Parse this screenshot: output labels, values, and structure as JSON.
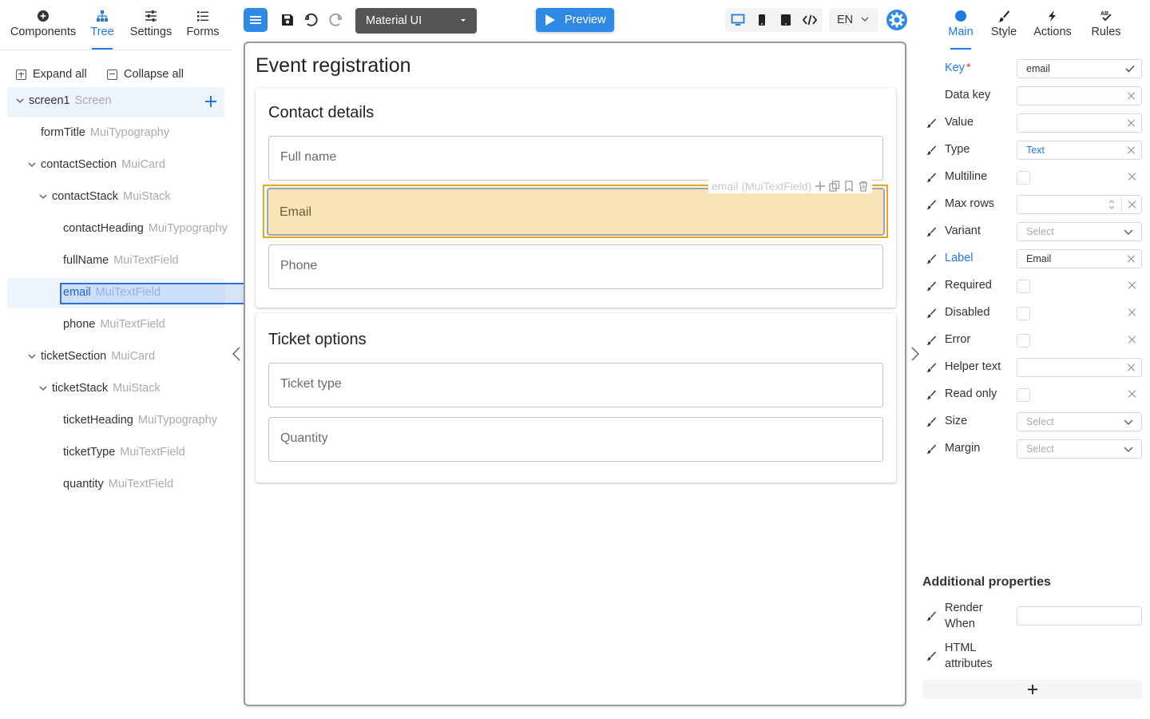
{
  "left_tabs": [
    {
      "label": "Components",
      "icon": "plus-circle-icon"
    },
    {
      "label": "Tree",
      "icon": "hierarchy-icon",
      "active": true
    },
    {
      "label": "Settings",
      "icon": "sliders-icon"
    },
    {
      "label": "Forms",
      "icon": "list-icon"
    }
  ],
  "tree_actions": {
    "expand_all": "Expand all",
    "collapse_all": "Collapse all"
  },
  "tree": [
    {
      "name": "screen1",
      "type": "Screen"
    },
    {
      "name": "formTitle",
      "type": "MuiTypography"
    },
    {
      "name": "contactSection",
      "type": "MuiCard"
    },
    {
      "name": "contactStack",
      "type": "MuiStack"
    },
    {
      "name": "contactHeading",
      "type": "MuiTypography"
    },
    {
      "name": "fullName",
      "type": "MuiTextField"
    },
    {
      "name": "email",
      "type": "MuiTextField",
      "selected": true
    },
    {
      "name": "phone",
      "type": "MuiTextField"
    },
    {
      "name": "ticketSection",
      "type": "MuiCard"
    },
    {
      "name": "ticketStack",
      "type": "MuiStack"
    },
    {
      "name": "ticketHeading",
      "type": "MuiTypography"
    },
    {
      "name": "ticketType",
      "type": "MuiTextField"
    },
    {
      "name": "quantity",
      "type": "MuiTextField"
    }
  ],
  "toolbar": {
    "theme": "Material UI",
    "preview": "Preview",
    "language": "EN"
  },
  "canvas": {
    "title": "Event registration",
    "contact_heading": "Contact details",
    "full_name": "Full name",
    "email": "Email",
    "phone": "Phone",
    "ticket_heading": "Ticket options",
    "ticket_type": "Ticket type",
    "quantity": "Quantity",
    "selected_label": "email (MuiTextField)"
  },
  "right_tabs": [
    {
      "label": "Main",
      "icon": "circle-icon",
      "active": true
    },
    {
      "label": "Style",
      "icon": "brush-icon"
    },
    {
      "label": "Actions",
      "icon": "lightning-icon"
    },
    {
      "label": "Rules",
      "icon": "rules-icon"
    }
  ],
  "props": {
    "key": {
      "label": "Key",
      "required": "*",
      "value": "email"
    },
    "data_key": {
      "label": "Data key",
      "value": ""
    },
    "value": {
      "label": "Value",
      "value": ""
    },
    "type": {
      "label": "Type",
      "value": "Text"
    },
    "multiline": {
      "label": "Multiline"
    },
    "max_rows": {
      "label": "Max rows",
      "value": ""
    },
    "variant": {
      "label": "Variant",
      "placeholder": "Select"
    },
    "label": {
      "label": "Label",
      "value": "Email"
    },
    "required": {
      "label": "Required"
    },
    "disabled": {
      "label": "Disabled"
    },
    "error": {
      "label": "Error"
    },
    "helper_text": {
      "label": "Helper text",
      "value": ""
    },
    "read_only": {
      "label": "Read only"
    },
    "size": {
      "label": "Size",
      "placeholder": "Select"
    },
    "margin": {
      "label": "Margin",
      "placeholder": "Select"
    }
  },
  "additional": {
    "title": "Additional properties",
    "render_when": "Render When",
    "html_attributes": "HTML attributes"
  },
  "colors": {
    "accent": "#1f7be6",
    "selection_fill": "#fbe3b8",
    "selection_border": "#f0a41b"
  }
}
